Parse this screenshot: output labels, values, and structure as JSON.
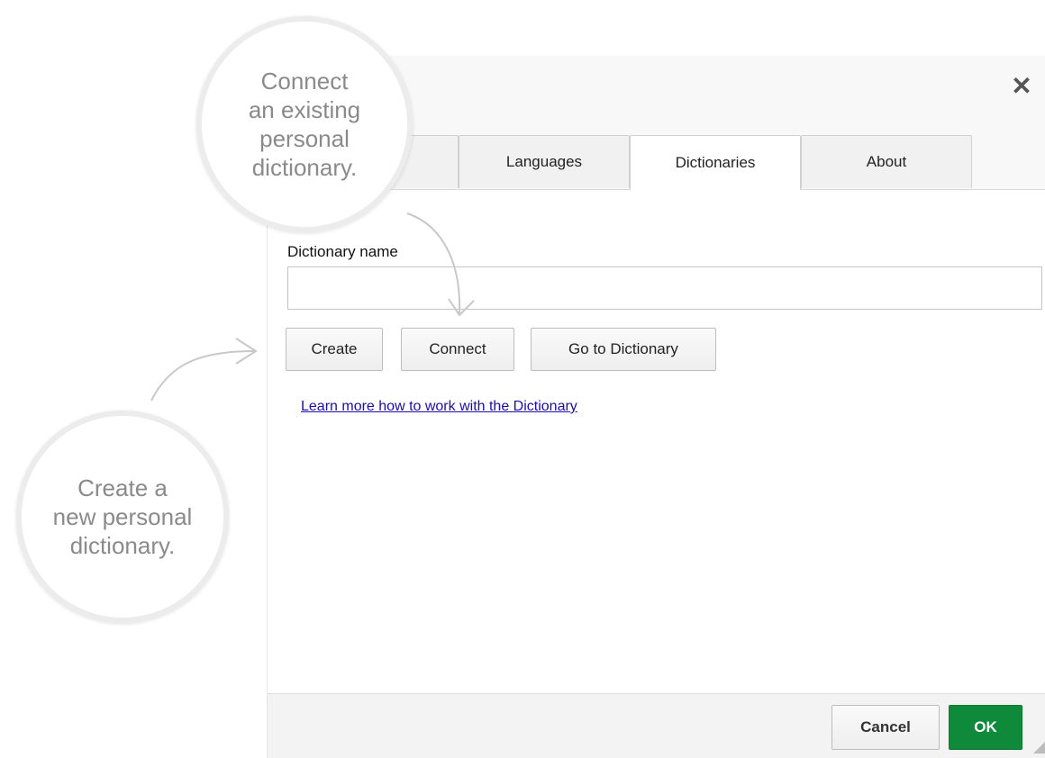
{
  "dialog": {
    "close_symbol": "✕",
    "tabs": [
      {
        "label": "",
        "active": false
      },
      {
        "label": "Languages",
        "active": false
      },
      {
        "label": "Dictionaries",
        "active": true
      },
      {
        "label": "About",
        "active": false
      }
    ],
    "field_label": "Dictionary name",
    "input": {
      "value": "",
      "placeholder": ""
    },
    "buttons": {
      "create": "Create",
      "connect": "Connect",
      "go_to": "Go to Dictionary"
    },
    "learn_more_link": "Learn more how to work with the Dictionary",
    "footer": {
      "cancel": "Cancel",
      "ok": "OK"
    }
  },
  "callouts": {
    "connect": "Connect\nan existing\npersonal\ndictionary.",
    "create": "Create a\nnew personal\ndictionary."
  },
  "colors": {
    "ok_green": "#0f8a3a",
    "link_blue": "#1a0dab",
    "callout_text": "#8a8a8a"
  }
}
